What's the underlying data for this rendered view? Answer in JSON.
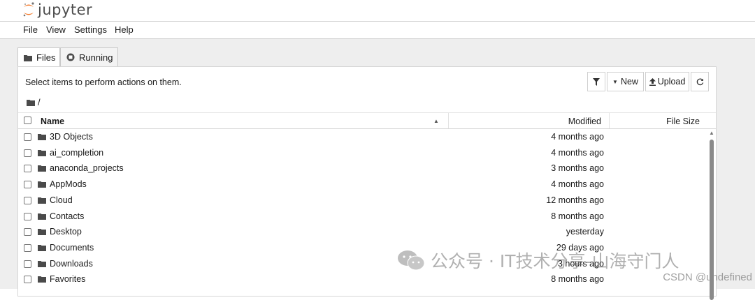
{
  "app": {
    "name": "jupyter"
  },
  "menu": [
    "File",
    "View",
    "Settings",
    "Help"
  ],
  "tabs": [
    {
      "label": "Files",
      "active": true
    },
    {
      "label": "Running",
      "active": false
    }
  ],
  "toolbar": {
    "hint": "Select items to perform actions on them.",
    "new_label": "New",
    "upload_label": "Upload"
  },
  "breadcrumb": "/",
  "columns": {
    "name": "Name",
    "modified": "Modified",
    "size": "File Size"
  },
  "files": [
    {
      "name": "3D Objects",
      "modified": "4 months ago"
    },
    {
      "name": "ai_completion",
      "modified": "4 months ago"
    },
    {
      "name": "anaconda_projects",
      "modified": "3 months ago"
    },
    {
      "name": "AppMods",
      "modified": "4 months ago"
    },
    {
      "name": "Cloud",
      "modified": "12 months ago"
    },
    {
      "name": "Contacts",
      "modified": "8 months ago"
    },
    {
      "name": "Desktop",
      "modified": "yesterday"
    },
    {
      "name": "Documents",
      "modified": "29 days ago"
    },
    {
      "name": "Downloads",
      "modified": "3 hours ago"
    },
    {
      "name": "Favorites",
      "modified": "8 months ago"
    }
  ],
  "watermark": {
    "text": "公众号 · IT技术分享-山海守门人",
    "site": "CSDN @undefined"
  },
  "colors": {
    "jupyter_orange": "#f37726",
    "folder": "#4a4a4a"
  }
}
